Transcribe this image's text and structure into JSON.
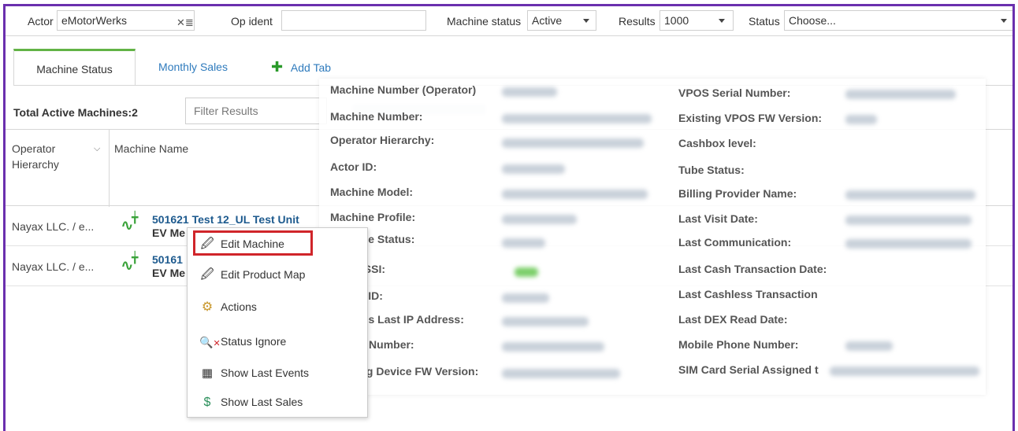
{
  "filters": {
    "actor_label": "Actor",
    "actor_value": "eMotorWerks",
    "op_ident_label": "Op ident",
    "op_ident_value": "",
    "machine_status_label": "Machine status",
    "machine_status_value": "Active",
    "results_label": "Results",
    "results_value": "1000",
    "status_label": "Status",
    "status_placeholder": "Choose..."
  },
  "tabs": [
    {
      "label": "Machine Status"
    },
    {
      "label": "Monthly Sales"
    },
    {
      "label": "Add Tab"
    }
  ],
  "summary": {
    "total_label": "Total Active Machines:2",
    "filter_placeholder": "Filter Results"
  },
  "table": {
    "headers": [
      "Operator Hierarchy",
      "Machine Name"
    ],
    "rows": [
      {
        "hierarchy": "Nayax LLC. / e...",
        "machine_line1": "501621 Test 12_UL Test Unit",
        "machine_line2": "EV Me"
      },
      {
        "hierarchy": "Nayax LLC. / e...",
        "machine_line1": "50161",
        "machine_line2": "EV Me"
      }
    ]
  },
  "context_menu": {
    "items": [
      {
        "label": "Edit Machine",
        "icon": "edit-machine-icon"
      },
      {
        "label": "Edit Product Map",
        "icon": "edit-product-map-icon"
      },
      {
        "label": "Actions",
        "icon": "gear-icon"
      },
      {
        "label": "Status Ignore",
        "icon": "search-x-icon"
      },
      {
        "label": "Show Last Events",
        "icon": "calendar-icon"
      },
      {
        "label": "Show Last Sales",
        "icon": "money-icon"
      }
    ]
  },
  "machine_info": {
    "left_labels": [
      "Machine Number (Operator)",
      "Machine Number:",
      "Operator Hierarchy:",
      "Actor ID:",
      "Machine Model:",
      "Machine Profile:",
      "Machine Status:",
      "Last RSSI:",
      "Monyx ID:",
      "Device's Last IP Address:",
      "Device Number:",
      "Existing Device FW Version:"
    ],
    "right_labels": [
      "VPOS Serial Number:",
      "Existing VPOS FW Version:",
      "Cashbox level:",
      "Tube Status:",
      "Billing Provider Name:",
      "Last Visit Date:",
      "Last Communication:",
      "Last Cash Transaction Date:",
      "Last Cashless Transaction Da",
      "Last DEX Read Date:",
      "Mobile Phone Number:",
      "SIM Card Serial Assigned to I"
    ]
  },
  "colors": {
    "frame": "#6a2fae",
    "active_tab": "#62b346",
    "link": "#2f7bbd",
    "machine_name": "#1d5a8e",
    "highlight": "#d0252a"
  }
}
